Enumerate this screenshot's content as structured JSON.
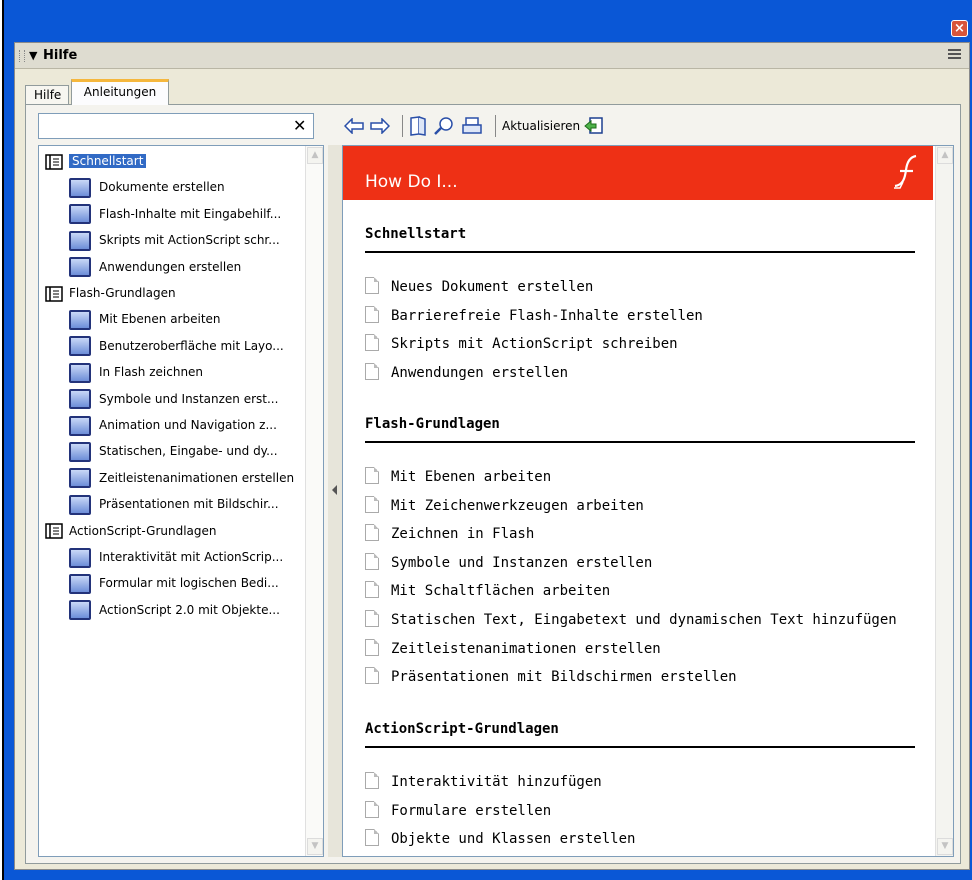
{
  "window": {
    "close_icon": "close-icon",
    "close_glyph": "×"
  },
  "panel": {
    "title": "Hilfe",
    "collapse_glyph": "▼"
  },
  "tabs": [
    {
      "label": "Hilfe",
      "active": false
    },
    {
      "label": "Anleitungen",
      "active": true
    }
  ],
  "search": {
    "value": "",
    "clear_glyph": "✕"
  },
  "toolbar": {
    "refresh_label": "Aktualisieren"
  },
  "tree": {
    "groups": [
      {
        "label": "Schnellstart",
        "selected": true,
        "items": [
          "Dokumente erstellen",
          "Flash-Inhalte mit Eingabehilf...",
          "Skripts mit ActionScript schr...",
          "Anwendungen erstellen"
        ]
      },
      {
        "label": "Flash-Grundlagen",
        "selected": false,
        "items": [
          "Mit Ebenen arbeiten",
          "Benutzeroberfläche mit Layo...",
          "In Flash zeichnen",
          "Symbole und Instanzen erst...",
          "Animation und Navigation z...",
          "Statischen, Eingabe- und dy...",
          "Zeitleistenanimationen erstellen",
          "Präsentationen mit Bildschir..."
        ]
      },
      {
        "label": "ActionScript-Grundlagen",
        "selected": false,
        "items": [
          "Interaktivität mit ActionScrip...",
          "Formular mit logischen Bedi...",
          "ActionScript 2.0 mit Objekte..."
        ]
      }
    ]
  },
  "doc": {
    "hero_title": "How Do I...",
    "sections": [
      {
        "heading": "Schnellstart",
        "items": [
          "Neues Dokument erstellen",
          "Barrierefreie Flash-Inhalte erstellen",
          "Skripts mit ActionScript schreiben",
          "Anwendungen erstellen"
        ]
      },
      {
        "heading": "Flash-Grundlagen",
        "items": [
          "Mit Ebenen arbeiten",
          "Mit Zeichenwerkzeugen arbeiten",
          "Zeichnen in Flash",
          "Symbole und Instanzen erstellen",
          "Mit Schaltflächen arbeiten",
          "Statischen Text, Eingabetext und dynamischen Text hinzufügen",
          "Zeitleistenanimationen erstellen",
          "Präsentationen mit Bildschirmen erstellen"
        ]
      },
      {
        "heading": "ActionScript-Grundlagen",
        "items": [
          "Interaktivität hinzufügen",
          "Formulare erstellen",
          "Objekte und Klassen erstellen"
        ]
      }
    ]
  },
  "colors": {
    "title_bar": "#0a57d6",
    "hero": "#ee3015",
    "selection": "#316ac5"
  }
}
